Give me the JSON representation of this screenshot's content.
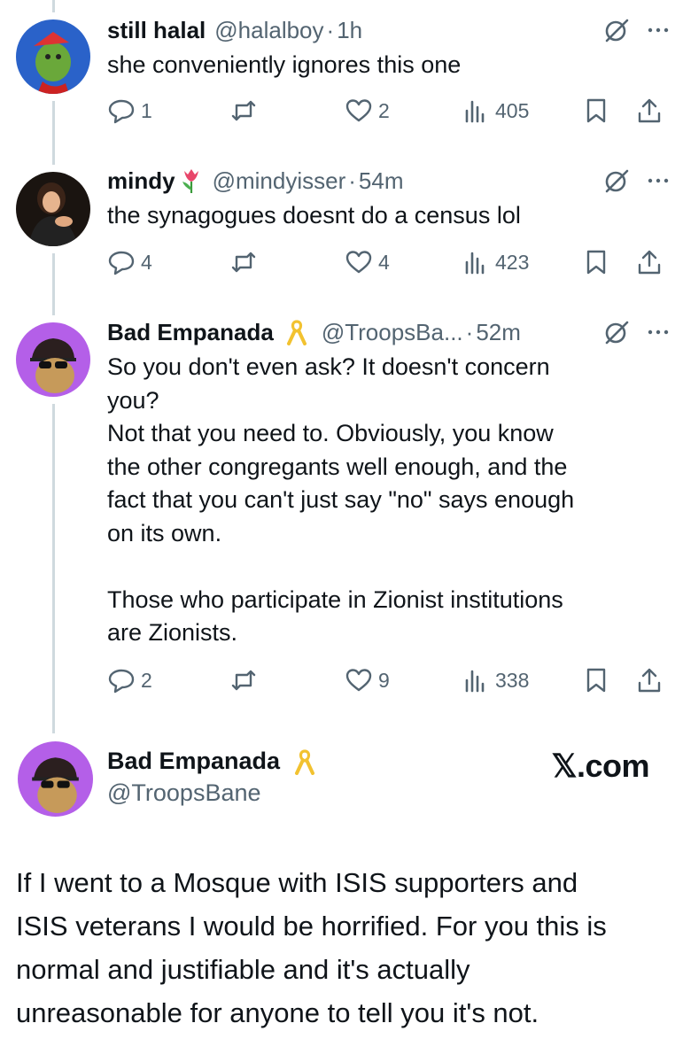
{
  "colors": {
    "text": "#0f1419",
    "secondary": "#536471",
    "thread_line": "#cfd9de",
    "avatar_purple": "#b45fe8"
  },
  "replies": [
    {
      "name": "still halal",
      "handle": "@halalboy",
      "time": "1h",
      "text": "she conveniently ignores this one",
      "replies": "1",
      "likes": "2",
      "views": "405"
    },
    {
      "name": "mindy",
      "name_emoji": "tulip",
      "handle": "@mindyisser",
      "time": "54m",
      "text": "the synagogues doesnt do a census lol",
      "replies": "4",
      "likes": "4",
      "views": "423"
    },
    {
      "name": "Bad Empanada",
      "name_emoji": "yellow-ribbon",
      "handle": "@TroopsBa...",
      "time": "52m",
      "text": "So you don't even ask? It doesn't concern\nyou?\nNot that you need to. Obviously, you know\nthe other congregants well enough, and the\nfact that you can't just say \"no\" says enough\non its own.\n\nThose who participate in Zionist institutions\nare Zionists.",
      "replies": "2",
      "likes": "9",
      "views": "338"
    }
  ],
  "main": {
    "name": "Bad Empanada",
    "name_emoji": "yellow-ribbon",
    "handle": "@TroopsBane",
    "brand": "𝕏.com",
    "text": "If I went to a Mosque with ISIS supporters and\nISIS veterans I would be horrified. For you this is\nnormal and justifiable and it's actually\nunreasonable for anyone to tell you it's not."
  }
}
